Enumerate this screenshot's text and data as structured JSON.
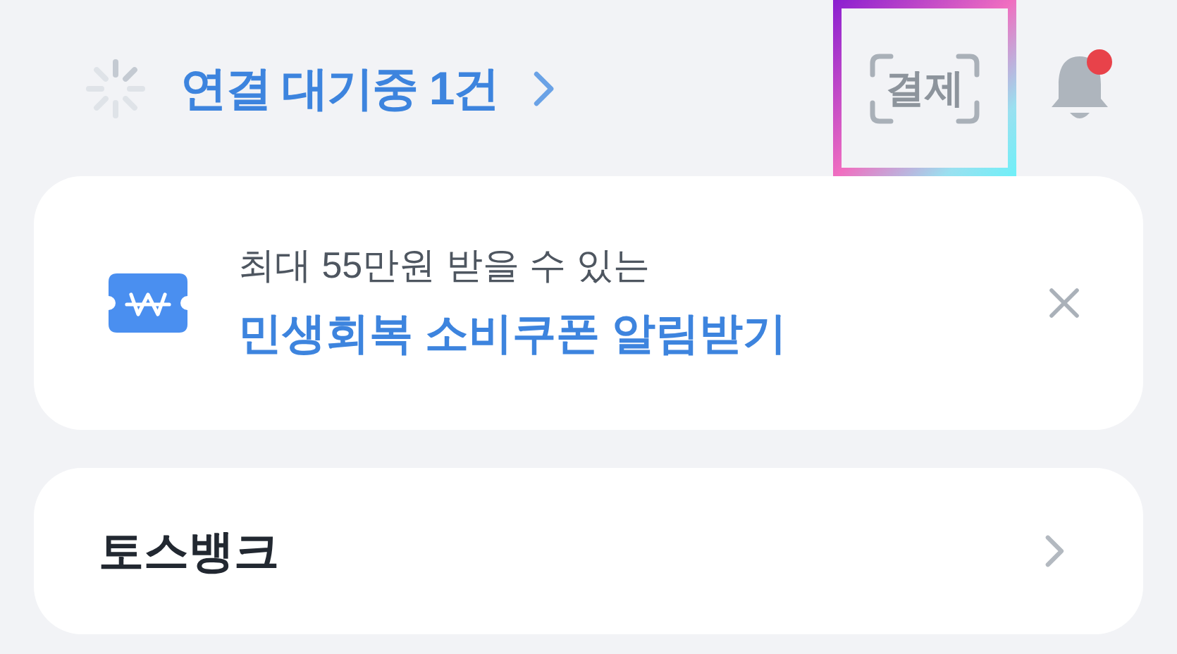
{
  "header": {
    "status": {
      "text": "연결 대기중 1건",
      "loading": true
    },
    "pay_button": {
      "label": "결제",
      "highlighted": true
    },
    "notifications": {
      "unread": true
    }
  },
  "banner": {
    "subtitle": "최대 55만원 받을 수 있는",
    "title": "민생회복 소비쿠폰 알림받기",
    "dismissible": true
  },
  "accounts": [
    {
      "label": "토스뱅크"
    }
  ]
}
